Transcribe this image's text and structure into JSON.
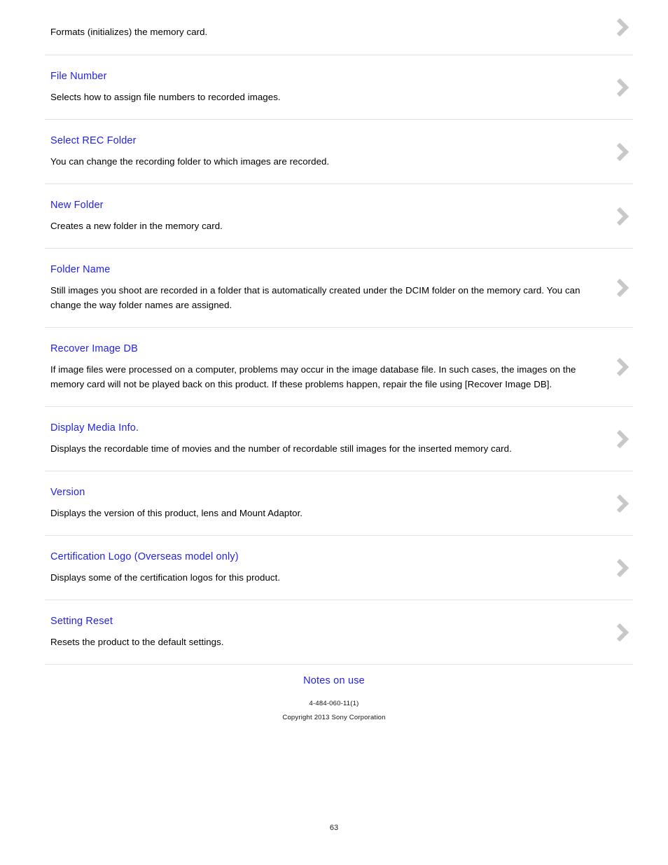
{
  "document": {
    "page_number": "63",
    "accent_link_color": "#2222ee",
    "divider_color": "#e2e2e2",
    "chevron_color": "#c8c8c8",
    "body_text_color": "#000000"
  },
  "entries": [
    {
      "title": "",
      "description": "Formats (initializes) the memory card.",
      "chevron": "chevron-right-icon"
    },
    {
      "title": "File Number",
      "description": "Selects how to assign file numbers to recorded images.",
      "chevron": "chevron-right-icon"
    },
    {
      "title": "Select REC Folder",
      "description": "You can change the recording folder to which images are recorded.",
      "chevron": "chevron-right-icon"
    },
    {
      "title": "New Folder",
      "description": "Creates a new folder in the memory card.",
      "chevron": "chevron-right-icon"
    },
    {
      "title": "Folder Name",
      "description": "Still images you shoot are recorded in a folder that is automatically created under the DCIM folder on the memory card. You can change the way folder names are assigned.",
      "chevron": "chevron-right-icon"
    },
    {
      "title": "Recover Image DB",
      "description": "If image files were processed on a computer, problems may occur in the image database file. In such cases, the images on the memory card will not be played back on this product. If these problems happen, repair the file using [Recover Image DB].",
      "chevron": "chevron-right-icon"
    },
    {
      "title": "Display Media Info.",
      "description": "Displays the recordable time of movies and the number of recordable still images for the inserted memory card.",
      "chevron": "chevron-right-icon"
    },
    {
      "title": "Version",
      "description": "Displays the version of this product, lens and Mount Adaptor.",
      "chevron": "chevron-right-icon"
    },
    {
      "title": "Certification Logo (Overseas model only)",
      "description": "Displays some of the certification logos for this product.",
      "chevron": "chevron-right-icon"
    },
    {
      "title": "Setting Reset",
      "description": "Resets the product to the default settings.",
      "chevron": "chevron-right-icon"
    }
  ],
  "footer": {
    "link_label": "Notes on use",
    "document_code": "4-484-060-11(1)",
    "copyright": "Copyright 2013 Sony Corporation"
  }
}
